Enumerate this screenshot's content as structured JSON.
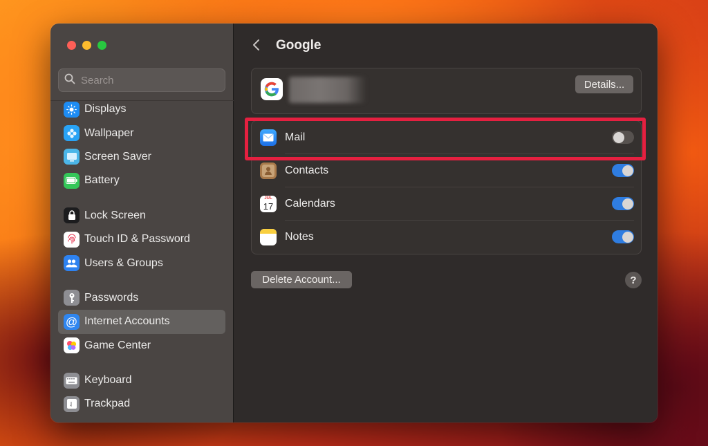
{
  "window": {
    "title": "Google"
  },
  "sidebar": {
    "search_placeholder": "Search",
    "groups": [
      [
        {
          "label": "Displays",
          "icon": "displays-icon",
          "color": "#1d8cf3"
        },
        {
          "label": "Wallpaper",
          "icon": "wallpaper-icon",
          "color": "#29a3f5"
        },
        {
          "label": "Screen Saver",
          "icon": "screen-saver-icon",
          "color": "#4cb6e8"
        },
        {
          "label": "Battery",
          "icon": "battery-icon",
          "color": "#34c759"
        }
      ],
      [
        {
          "label": "Lock Screen",
          "icon": "lock-icon",
          "color": "#1c1c1e"
        },
        {
          "label": "Touch ID & Password",
          "icon": "fingerprint-icon",
          "color": "#ffffff"
        },
        {
          "label": "Users & Groups",
          "icon": "users-icon",
          "color": "#2e82f0"
        }
      ],
      [
        {
          "label": "Passwords",
          "icon": "key-icon",
          "color": "#8e8e93"
        },
        {
          "label": "Internet Accounts",
          "icon": "at-icon",
          "color": "#2f86f0",
          "active": true
        },
        {
          "label": "Game Center",
          "icon": "game-center-icon",
          "color": "#ffffff"
        }
      ],
      [
        {
          "label": "Keyboard",
          "icon": "keyboard-icon",
          "color": "#8e8e93"
        },
        {
          "label": "Trackpad",
          "icon": "trackpad-icon",
          "color": "#8e8e93"
        }
      ]
    ]
  },
  "account": {
    "details_label": "Details..."
  },
  "apps": [
    {
      "label": "Mail",
      "icon": "mail-icon",
      "enabled": false
    },
    {
      "label": "Contacts",
      "icon": "contacts-icon",
      "enabled": true
    },
    {
      "label": "Calendars",
      "icon": "calendar-icon",
      "enabled": true,
      "icon_month": "JUL",
      "icon_day": "17"
    },
    {
      "label": "Notes",
      "icon": "notes-icon",
      "enabled": true
    }
  ],
  "footer": {
    "delete_label": "Delete Account...",
    "help_label": "?"
  },
  "colors": {
    "accent": "#2f7de1",
    "highlight": "#e52040"
  }
}
